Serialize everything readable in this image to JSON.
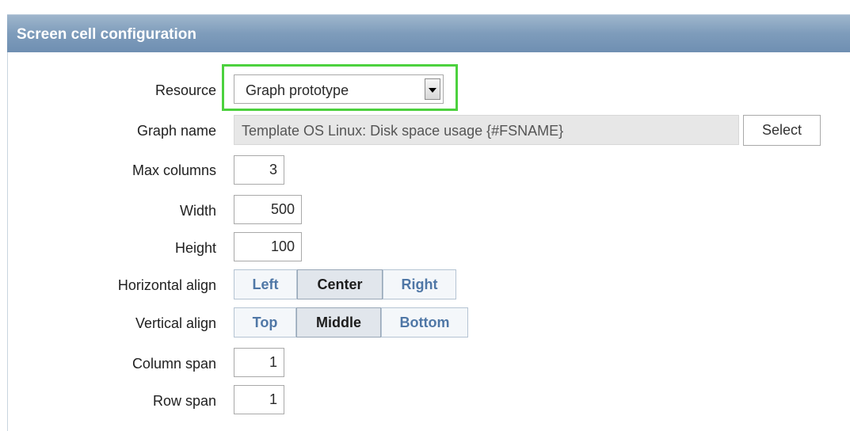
{
  "panel": {
    "title": "Screen cell configuration"
  },
  "form": {
    "resource": {
      "label": "Resource",
      "value": "Graph prototype"
    },
    "graph_name": {
      "label": "Graph name",
      "value": "Template OS Linux: Disk space usage {#FSNAME}",
      "button": "Select"
    },
    "max_columns": {
      "label": "Max columns",
      "value": "3"
    },
    "width": {
      "label": "Width",
      "value": "500"
    },
    "height": {
      "label": "Height",
      "value": "100"
    },
    "horizontal_align": {
      "label": "Horizontal align",
      "options": [
        "Left",
        "Center",
        "Right"
      ],
      "selected": "Center"
    },
    "vertical_align": {
      "label": "Vertical align",
      "options": [
        "Top",
        "Middle",
        "Bottom"
      ],
      "selected": "Middle"
    },
    "column_span": {
      "label": "Column span",
      "value": "1"
    },
    "row_span": {
      "label": "Row span",
      "value": "1"
    }
  },
  "colors": {
    "title_bar": "#7e9cbb",
    "highlight": "#4cd13e",
    "link_text": "#4f77a6"
  }
}
